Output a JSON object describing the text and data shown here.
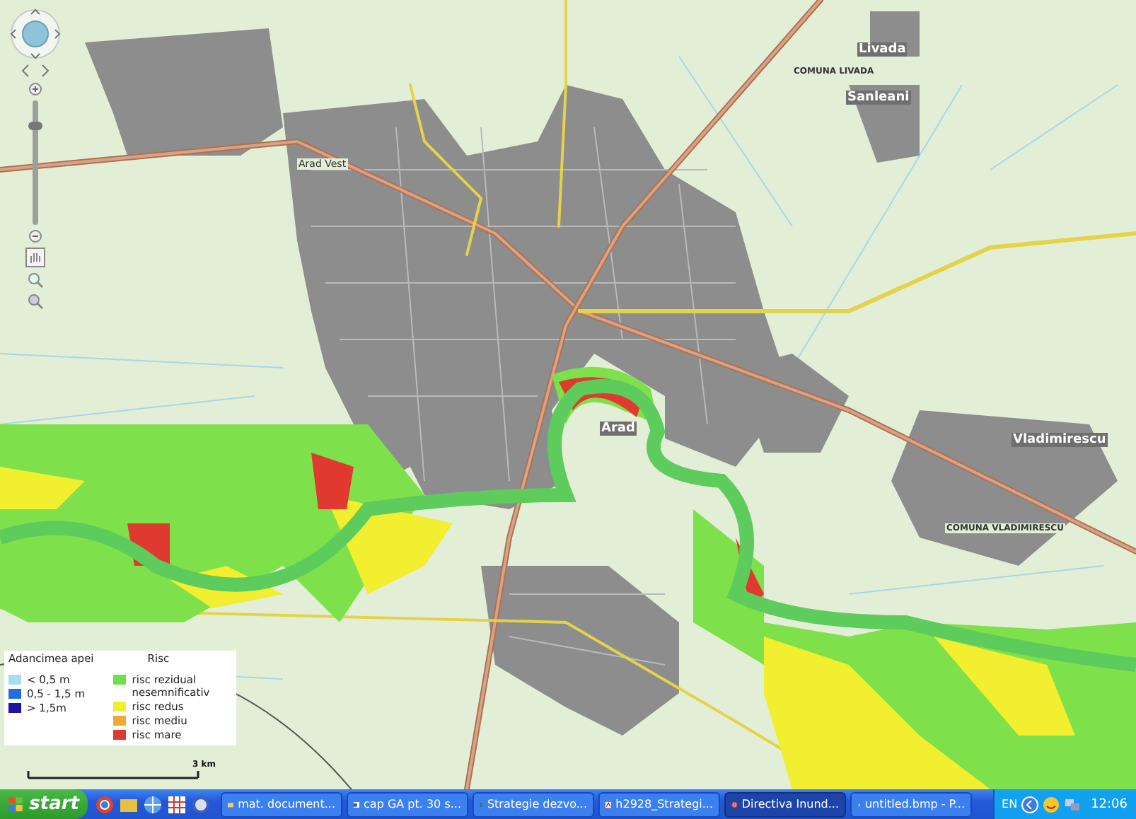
{
  "map": {
    "zoom_slider": {
      "level": 0.8
    },
    "places": [
      {
        "name": "Livada",
        "kind": "town"
      },
      {
        "name": "COMUNA LIVADA",
        "kind": "commune"
      },
      {
        "name": "Sanleani",
        "kind": "town"
      },
      {
        "name": "Arad Vest",
        "kind": "station"
      },
      {
        "name": "Arad",
        "kind": "town"
      },
      {
        "name": "Vladimirescu",
        "kind": "town"
      },
      {
        "name": "COMUNA VLADIMIRESCU",
        "kind": "commune"
      }
    ],
    "legend": {
      "depth_title": "Adancimea apei",
      "risk_title": "Risc",
      "depth_items": [
        {
          "label": "< 0,5 m",
          "color": "#a8dcf0"
        },
        {
          "label": "0,5 - 1,5 m",
          "color": "#1f6fe0"
        },
        {
          "label": "> 1,5m",
          "color": "#2010a8"
        }
      ],
      "risk_items": [
        {
          "label": "risc rezidual nesemnificativ",
          "color": "#6ee04a"
        },
        {
          "label": "risc redus",
          "color": "#f2ee30"
        },
        {
          "label": "risc mediu",
          "color": "#f0a838"
        },
        {
          "label": "risc mare",
          "color": "#e03a30"
        }
      ]
    },
    "scale": "3 km"
  },
  "taskbar": {
    "start": "start",
    "tasks": [
      {
        "label": "mat. document...",
        "kind": "folder",
        "selected": false
      },
      {
        "label": "cap GA pt. 30 s...",
        "kind": "word",
        "selected": false
      },
      {
        "label": "Strategie dezvo...",
        "kind": "archive",
        "selected": false
      },
      {
        "label": "h2928_Strategi...",
        "kind": "pdf",
        "selected": false
      },
      {
        "label": "Directiva Inund...",
        "kind": "browser",
        "selected": true
      },
      {
        "label": "untitled.bmp - P...",
        "kind": "paint",
        "selected": false
      }
    ],
    "language": "EN",
    "clock": "12:06"
  }
}
